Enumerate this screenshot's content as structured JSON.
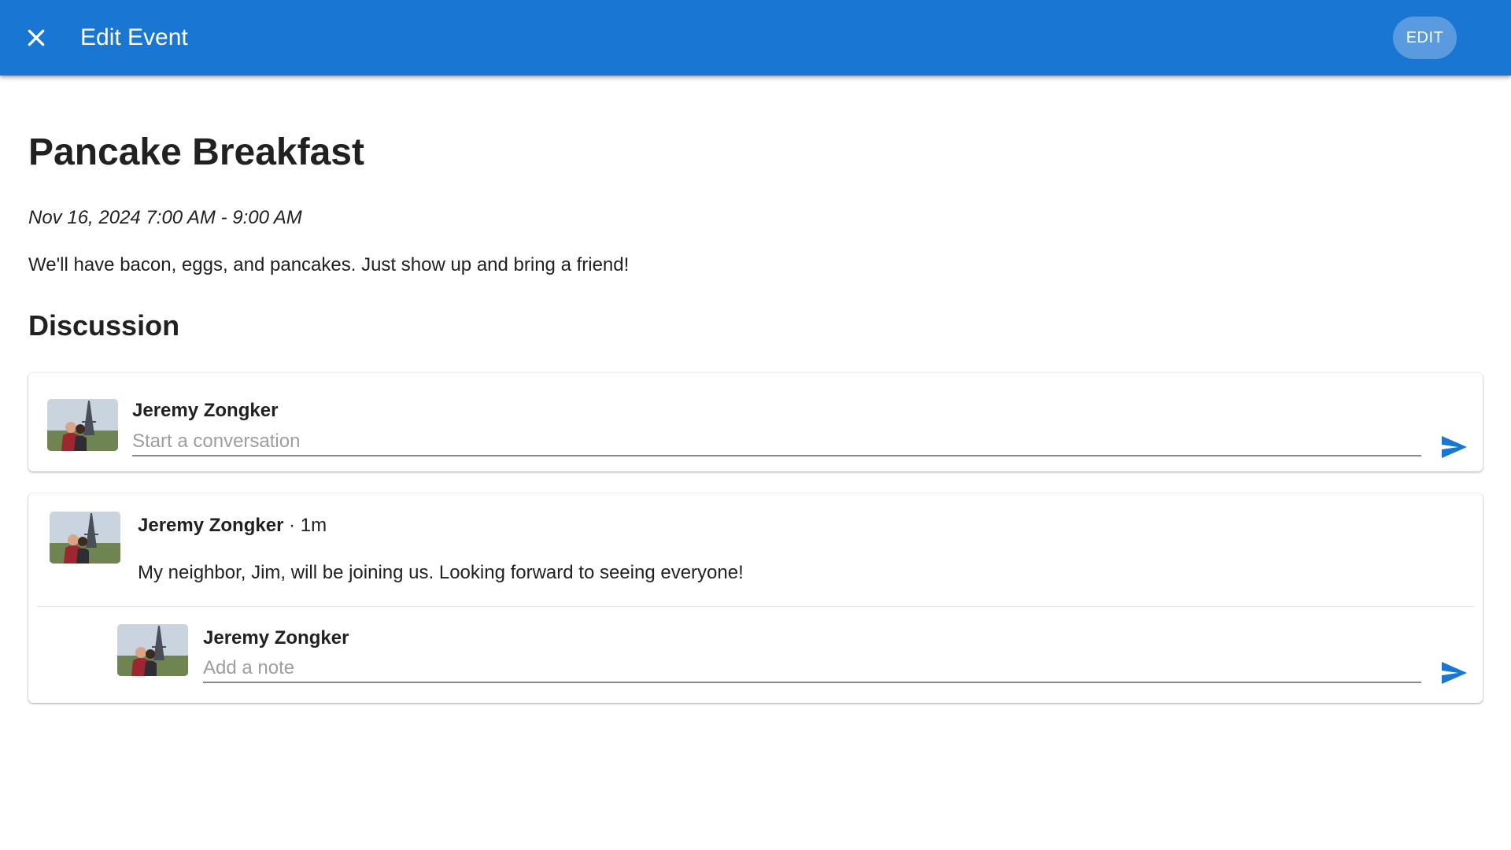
{
  "appbar": {
    "title": "Edit Event",
    "edit_label": "EDIT",
    "close_icon": "close-icon",
    "color": "#1976d2"
  },
  "event": {
    "title": "Pancake Breakfast",
    "datetime": "Nov 16, 2024 7:00 AM - 9:00 AM",
    "description": "We'll have bacon, eggs, and pancakes. Just show up and bring a friend!"
  },
  "discussion": {
    "heading": "Discussion",
    "new_post": {
      "author": "Jeremy Zongker",
      "placeholder": "Start a conversation",
      "send_icon": "send-icon"
    },
    "thread": {
      "author": "Jeremy Zongker",
      "separator": "·",
      "time": "1m",
      "text": "My neighbor, Jim, will be joining us. Looking forward to seeing everyone!",
      "reply": {
        "author": "Jeremy Zongker",
        "placeholder": "Add a note",
        "send_icon": "send-icon"
      }
    }
  },
  "colors": {
    "accent": "#1976d2",
    "edit_button": "#5a9be0"
  }
}
